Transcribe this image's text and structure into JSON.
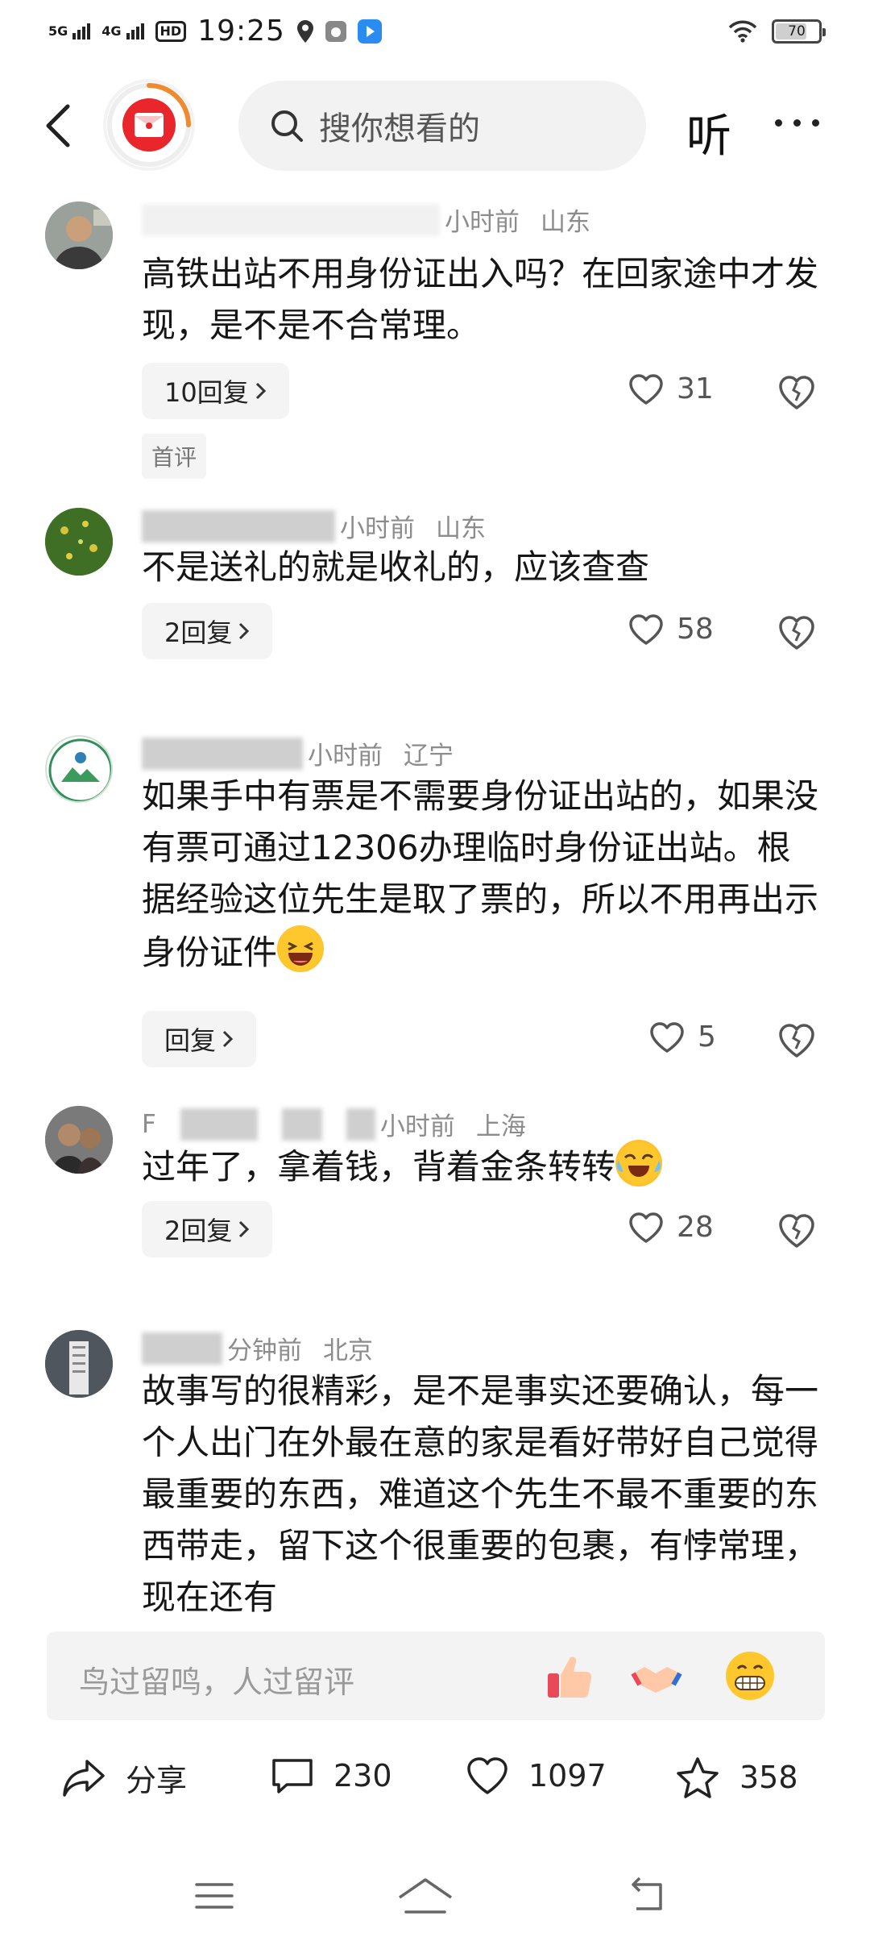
{
  "status_bar": {
    "network1": "5G",
    "network2": "4G",
    "hd": "HD",
    "time": "19:25",
    "battery": "70"
  },
  "top_bar": {
    "search_placeholder": "搜你想看的",
    "listen_label": "听"
  },
  "comments": [
    {
      "time": "小时前",
      "location": "山东",
      "text": "高铁出站不用身份证出入吗？在回家途中才发现，是不是不合常理。",
      "reply_label": "10回复",
      "likes": "31",
      "tag": "首评"
    },
    {
      "time": "小时前",
      "location": "山东",
      "text": "不是送礼的就是收礼的，应该查查",
      "reply_label": "2回复",
      "likes": "58"
    },
    {
      "time": "小时前",
      "location": "辽宁",
      "text": "如果手中有票是不需要身份证出站的，如果没有票可通过12306办理临时身份证出站。根据经验这位先生是取了票的，所以不用再出示身份证件",
      "reply_label": "回复",
      "likes": "5"
    },
    {
      "name_initial": "F",
      "time": "小时前",
      "location": "上海",
      "text": "过年了，拿着钱，背着金条转转",
      "reply_label": "2回复",
      "likes": "28"
    },
    {
      "time": "分钟前",
      "location": "北京",
      "text": "故事写的很精彩，是不是事实还要确认，每一个人出门在外最在意的家是看好带好自己觉得最重要的东西，难道这个先生不最不重要的东西带走，留下这个很重要的包裹，有悖常理，现在还有"
    }
  ],
  "input_bar": {
    "placeholder": "鸟过留鸣，人过留评"
  },
  "action_bar": {
    "share_label": "分享",
    "comment_count": "230",
    "like_count": "1097",
    "favorite_count": "358"
  }
}
